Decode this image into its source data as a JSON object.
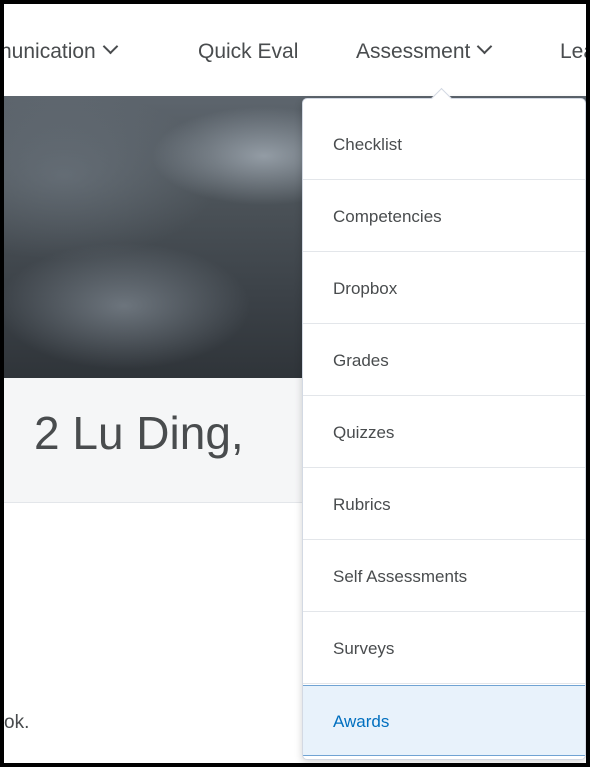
{
  "nav": {
    "items": [
      {
        "label": "nunication",
        "has_chevron": true
      },
      {
        "label": "Quick Eval",
        "has_chevron": false
      },
      {
        "label": "Assessment",
        "has_chevron": true
      },
      {
        "label": "Lea",
        "has_chevron": false
      }
    ]
  },
  "page": {
    "title": "2 Lu Ding,",
    "footer_text": "ok."
  },
  "dropdown": {
    "items": [
      {
        "label": "Checklist"
      },
      {
        "label": "Competencies"
      },
      {
        "label": "Dropbox"
      },
      {
        "label": "Grades"
      },
      {
        "label": "Quizzes"
      },
      {
        "label": "Rubrics"
      },
      {
        "label": "Self Assessments"
      },
      {
        "label": "Surveys"
      },
      {
        "label": "Awards",
        "active": true
      }
    ]
  },
  "colors": {
    "text": "#494c4e",
    "accent": "#006fbf",
    "active_bg": "#e8f2fb"
  }
}
